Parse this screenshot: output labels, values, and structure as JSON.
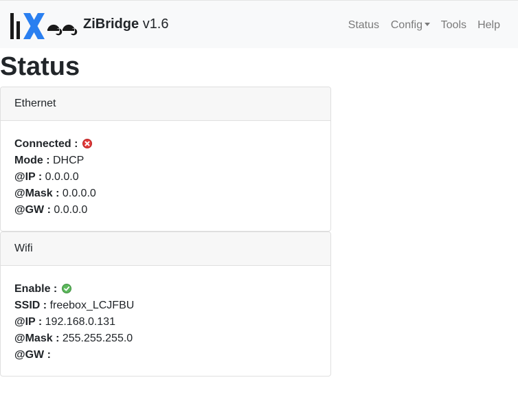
{
  "navbar": {
    "brand_name": "ZiBridge",
    "brand_version": "v1.6",
    "logo_text": "lixee",
    "links": {
      "status": "Status",
      "config": "Config",
      "tools": "Tools",
      "help": "Help"
    }
  },
  "page": {
    "title": "Status"
  },
  "ethernet": {
    "header": "Ethernet",
    "connected_label": "Connected :",
    "connected_status": "error-icon",
    "mode_label": "Mode :",
    "mode_value": "DHCP",
    "ip_label": "@IP :",
    "ip_value": "0.0.0.0",
    "mask_label": "@Mask :",
    "mask_value": "0.0.0.0",
    "gw_label": "@GW :",
    "gw_value": "0.0.0.0"
  },
  "wifi": {
    "header": "Wifi",
    "enable_label": "Enable :",
    "enable_status": "check-icon",
    "ssid_label": "SSID :",
    "ssid_value": "freebox_LCJFBU",
    "ip_label": "@IP :",
    "ip_value": "192.168.0.131",
    "mask_label": "@Mask :",
    "mask_value": "255.255.255.0",
    "gw_label": "@GW :",
    "gw_value": ""
  },
  "colors": {
    "navbar_bg": "#f8f9fa",
    "nav_link": "#7a7a7a",
    "error": "#e03a3a",
    "success": "#5cb85c",
    "card_header_bg": "#f7f7f7"
  }
}
